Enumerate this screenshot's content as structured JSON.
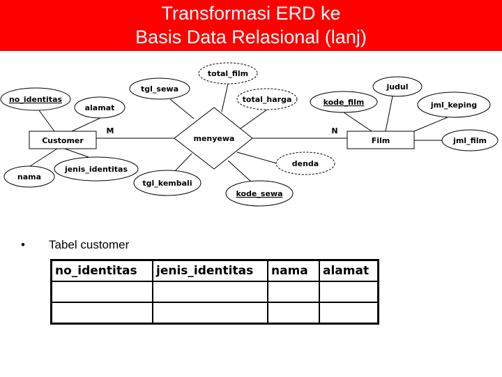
{
  "slide": {
    "title_line1": "Transformasi ERD ke",
    "title_line2": "Basis Data Relasional (lanj)",
    "title_bg_color": "#ff0000"
  },
  "erd": {
    "entities": [
      {
        "id": "customer",
        "label": "Customer"
      },
      {
        "id": "film",
        "label": "Film"
      }
    ],
    "relationship": {
      "id": "menyewa",
      "label": "menyewa"
    },
    "cardinality": {
      "customer_side": "M",
      "film_side": "N"
    },
    "attributes": [
      {
        "id": "no_identitas",
        "label": "no_identitas",
        "owner": "customer",
        "key": true,
        "derived": false
      },
      {
        "id": "alamat",
        "label": "alamat",
        "owner": "customer",
        "key": false,
        "derived": false
      },
      {
        "id": "nama",
        "label": "nama",
        "owner": "customer",
        "key": false,
        "derived": false
      },
      {
        "id": "jenis_identitas",
        "label": "jenis_identitas",
        "owner": "customer",
        "key": false,
        "derived": false
      },
      {
        "id": "tgl_sewa",
        "label": "tgl_sewa",
        "owner": "menyewa",
        "key": false,
        "derived": false
      },
      {
        "id": "total_film",
        "label": "total_film",
        "owner": "menyewa",
        "key": false,
        "derived": true
      },
      {
        "id": "total_harga",
        "label": "total_harga",
        "owner": "menyewa",
        "key": false,
        "derived": true
      },
      {
        "id": "tgl_kembali",
        "label": "tgl_kembali",
        "owner": "menyewa",
        "key": false,
        "derived": false
      },
      {
        "id": "kode_sewa",
        "label": "kode_sewa",
        "owner": "menyewa",
        "key": true,
        "derived": false
      },
      {
        "id": "denda",
        "label": "denda",
        "owner": "menyewa",
        "key": false,
        "derived": true
      },
      {
        "id": "kode_film",
        "label": "kode_film",
        "owner": "film",
        "key": true,
        "derived": false
      },
      {
        "id": "judul",
        "label": "judul",
        "owner": "film",
        "key": false,
        "derived": false
      },
      {
        "id": "jml_keping",
        "label": "jml_keping",
        "owner": "film",
        "key": false,
        "derived": false
      },
      {
        "id": "jml_film",
        "label": "jml_film",
        "owner": "film",
        "key": false,
        "derived": false
      }
    ]
  },
  "content": {
    "bullet": "•",
    "bullet_text": "Tabel customer",
    "table": {
      "headers": [
        "no_identitas",
        "jenis_identitas",
        "nama",
        "alamat"
      ],
      "rows": [
        [
          "",
          "",
          "",
          ""
        ],
        [
          "",
          "",
          "",
          ""
        ]
      ]
    }
  }
}
